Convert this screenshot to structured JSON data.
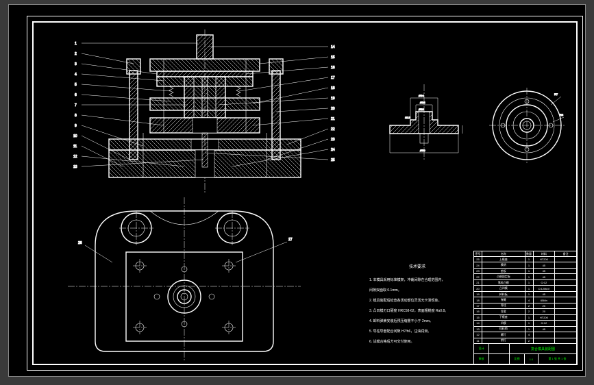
{
  "drawing": {
    "title": "装配图",
    "part_number": "复合模具",
    "scale": "1:1",
    "material": "",
    "tech_req_title": "技术要求",
    "tech_req_lines": [
      "1. 本模具采用标准模架，冲裁间隙在合理范围内，",
      "   间隙双面取 0.1mm。",
      "2. 模具装配后检查各活动部位灵活无卡滞现象。",
      "3. 凸凹模刃口硬度 HRC58-62，表面粗糙度 Ra0.8。",
      "4. 卸料弹簧安装后预压缩量不小于 2mm。",
      "5. 导柱导套配合间隙 H7/h6，注油润滑。",
      "6. 试模合格后方可交付使用。"
    ],
    "section_view": {
      "dims": {
        "d1": "Ø34",
        "d2": "Ø24",
        "d3": "Ø20",
        "w1": "15.5",
        "h1": "Ø50"
      }
    },
    "plan_view": {
      "dims": {
        "r1": "R7",
        "r2": "R3"
      }
    },
    "balloons_left": [
      "1",
      "2",
      "3",
      "4",
      "5",
      "6",
      "7",
      "8",
      "9",
      "10",
      "11",
      "12",
      "13"
    ],
    "balloons_right": [
      "14",
      "15",
      "16",
      "17",
      "18",
      "19",
      "20",
      "21",
      "22",
      "23",
      "24",
      "25"
    ],
    "balloons_bottom": [
      "26",
      "27"
    ]
  },
  "title_block": {
    "header": [
      "序号",
      "名称",
      "数量",
      "材料",
      "备注"
    ],
    "rows": [
      [
        "25",
        "上模座",
        "1",
        "HT200",
        ""
      ],
      [
        "24",
        "模柄",
        "1",
        "45",
        ""
      ],
      [
        "23",
        "垫板",
        "1",
        "45",
        ""
      ],
      [
        "22",
        "凸模固定板",
        "1",
        "45",
        ""
      ],
      [
        "21",
        "落料凸模",
        "1",
        "Cr12",
        ""
      ],
      [
        "20",
        "凸凹模",
        "1",
        "Cr12MoV",
        ""
      ],
      [
        "19",
        "卸料板",
        "1",
        "45",
        ""
      ],
      [
        "18",
        "弹簧",
        "4",
        "65Mn",
        ""
      ],
      [
        "17",
        "导柱",
        "2",
        "20",
        ""
      ],
      [
        "16",
        "导套",
        "2",
        "20",
        ""
      ],
      [
        "15",
        "下模座",
        "1",
        "HT200",
        ""
      ],
      [
        "14",
        "凹模",
        "1",
        "Cr12",
        ""
      ],
      [
        "13",
        "挡料销",
        "1",
        "45",
        ""
      ],
      [
        "12",
        "螺钉",
        "4",
        "",
        ""
      ],
      [
        "11",
        "销钉",
        "2",
        "",
        ""
      ]
    ],
    "footer": {
      "designed_label": "设计",
      "designed_by": "",
      "checked_label": "审核",
      "drawing_title": "复合模具装配图",
      "sheet": "第 1 张 共 1 张",
      "scale_label": "比例",
      "scale_value": "1:1"
    }
  }
}
